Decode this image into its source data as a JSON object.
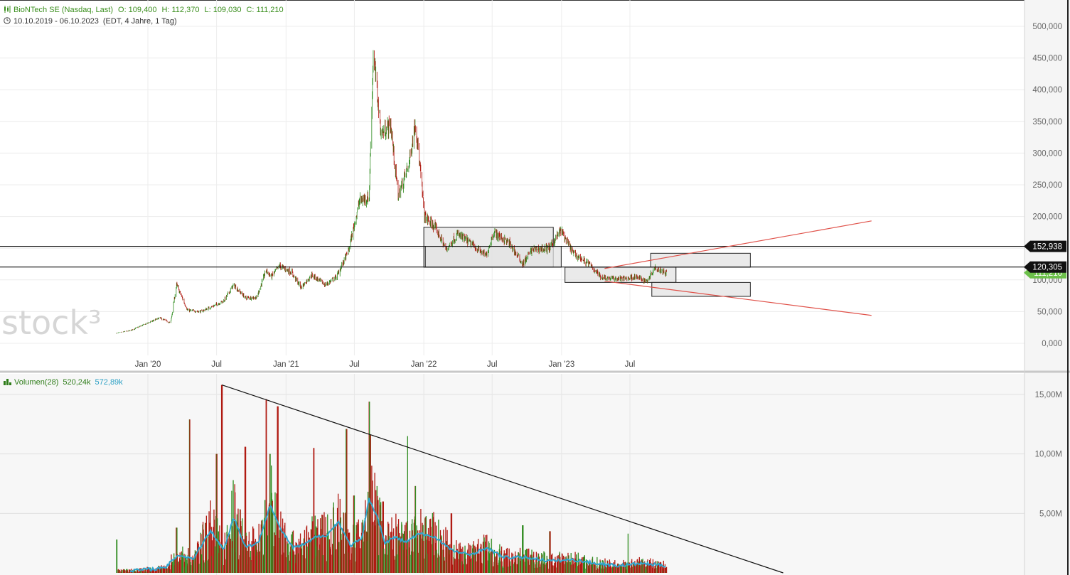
{
  "header": {
    "instrument": "BioNTech SE (Nasdaq, Last)",
    "open": "O: 109,400",
    "high": "H: 112,370",
    "low": "L: 109,030",
    "close": "C: 111,210",
    "range": "10.10.2019 - 06.10.2023",
    "range_note": "(EDT, 4 Jahre, 1 Tag)"
  },
  "volume_header": {
    "title": "Volumen(28)",
    "value1": "520,24k",
    "value2": "572,89k"
  },
  "watermark": "stock³",
  "price_axis_labels": [
    "500,000",
    "450,000",
    "400,000",
    "350,000",
    "300,000",
    "250,000",
    "200,000",
    "150,000",
    "100,000",
    "50,000",
    "0,000"
  ],
  "volume_axis_labels": [
    "15,00M",
    "10,00M",
    "5,00M"
  ],
  "x_axis_labels": [
    "Jan '20",
    "Jul",
    "Jan '21",
    "Jul",
    "Jan '22",
    "Jul",
    "Jan '23",
    "Jul"
  ],
  "horizontal_level_labels": [
    "152,938",
    "120,305"
  ],
  "current_price_label": "111,210",
  "colors": {
    "up": "#2e8b1e",
    "down": "#b01a12",
    "volume_ma": "#2fa6cf",
    "trendline_red": "#e0524a",
    "level_label_bg": "#111111",
    "current_label_bg": "#6cc04a",
    "box_fill": "#e3e3e3"
  },
  "chart_data": [
    {
      "type": "line",
      "chart_kind": "candlestick",
      "x_type": "date",
      "x_range": [
        "2019-10-10",
        "2023-10-06"
      ],
      "ylim": [
        0,
        500
      ],
      "series": [
        {
          "x": [
            "2019-10-10",
            "2019-11-15",
            "2019-12-20",
            "2020-02-01",
            "2020-03-01",
            "2020-03-17",
            "2020-04-15",
            "2020-05-20",
            "2020-06-20",
            "2020-07-20",
            "2020-08-15",
            "2020-09-15",
            "2020-10-15",
            "2020-11-09",
            "2020-11-23",
            "2020-12-15",
            "2021-01-15",
            "2021-02-10",
            "2021-03-10",
            "2021-04-15",
            "2021-05-15",
            "2021-06-15",
            "2021-07-15",
            "2021-08-09",
            "2021-08-20",
            "2021-09-10",
            "2021-10-05",
            "2021-10-25",
            "2021-11-22",
            "2021-12-10",
            "2022-01-03",
            "2022-02-01",
            "2022-03-01",
            "2022-04-01",
            "2022-05-10",
            "2022-06-15",
            "2022-07-05",
            "2022-08-15",
            "2022-09-20",
            "2022-10-15",
            "2022-11-30",
            "2022-12-30",
            "2023-02-01",
            "2023-03-15",
            "2023-04-15",
            "2023-05-15",
            "2023-06-15",
            "2023-07-15",
            "2023-08-15",
            "2023-09-05",
            "2023-10-06"
          ],
          "y": [
            16,
            20,
            29,
            40,
            32,
            92,
            52,
            50,
            58,
            67,
            92,
            72,
            72,
            115,
            105,
            122,
            112,
            88,
            108,
            92,
            105,
            145,
            225,
            230,
            458,
            330,
            345,
            232,
            282,
            350,
            200,
            182,
            148,
            172,
            155,
            138,
            175,
            158,
            125,
            148,
            150,
            178,
            142,
            125,
            105,
            102,
            102,
            105,
            98,
            120,
            111
          ]
        }
      ],
      "horizontal_levels": [
        152.938,
        120.305
      ],
      "current_price": 111.21,
      "zones": [
        {
          "x": [
            "2022-01-01",
            "2022-12-10"
          ],
          "y": [
            120,
            183
          ]
        },
        {
          "x": [
            "2022-01-05",
            "2022-12-31"
          ],
          "y": [
            120,
            153
          ]
        },
        {
          "x": [
            "2023-01-10",
            "2023-10-31"
          ],
          "y": [
            96,
            120
          ]
        },
        {
          "x": [
            "2023-08-25",
            "2024-05-15"
          ],
          "y": [
            120,
            142
          ]
        },
        {
          "x": [
            "2023-08-28",
            "2024-05-15"
          ],
          "y": [
            74,
            96
          ]
        }
      ],
      "trendlines": [
        {
          "x": [
            "2023-04-25",
            "2025-04-01"
          ],
          "y": [
            118,
            193
          ]
        },
        {
          "x": [
            "2023-04-25",
            "2025-04-01"
          ],
          "y": [
            98,
            44
          ]
        }
      ]
    },
    {
      "type": "bar",
      "title": "Volumen(28)",
      "x_type": "date",
      "x_range": [
        "2019-10-10",
        "2023-10-06"
      ],
      "ylim": [
        0,
        17.0
      ],
      "units": "M",
      "ma_period": 28,
      "spikes": {
        "x": [
          "2019-10-10",
          "2020-03-17",
          "2020-04-20",
          "2020-06-01",
          "2020-07-01",
          "2020-07-15",
          "2020-08-15",
          "2020-09-15",
          "2020-11-09",
          "2020-11-20",
          "2020-12-10",
          "2021-02-20",
          "2021-03-15",
          "2021-05-10",
          "2021-06-10",
          "2021-06-30",
          "2021-08-09",
          "2021-08-12",
          "2021-09-15",
          "2021-11-20",
          "2021-12-10",
          "2022-03-15",
          "2022-09-20",
          "2022-12-01",
          "2023-06-25"
        ],
        "y": [
          2.8,
          3.8,
          12.9,
          4.2,
          10.0,
          15.8,
          7.8,
          10.6,
          14.6,
          10.0,
          14.0,
          3.6,
          10.5,
          4.0,
          12.1,
          6.5,
          14.4,
          11.6,
          6.0,
          11.5,
          7.3,
          5.0,
          4.0,
          3.5,
          3.3
        ]
      },
      "moving_average": {
        "x": [
          "2019-11-15",
          "2020-02-15",
          "2020-03-20",
          "2020-05-01",
          "2020-06-15",
          "2020-07-20",
          "2020-08-15",
          "2020-09-15",
          "2020-10-20",
          "2020-11-20",
          "2020-12-15",
          "2021-01-20",
          "2021-02-20",
          "2021-03-20",
          "2021-04-20",
          "2021-05-20",
          "2021-06-20",
          "2021-07-20",
          "2021-08-09",
          "2021-08-30",
          "2021-09-20",
          "2021-10-15",
          "2021-11-15",
          "2021-12-20",
          "2022-02-01",
          "2022-03-15",
          "2022-05-01",
          "2022-06-15",
          "2022-08-01",
          "2022-10-01",
          "2022-12-01",
          "2023-02-01",
          "2023-04-01",
          "2023-06-01",
          "2023-08-01",
          "2023-10-06"
        ],
        "y": [
          0.2,
          0.4,
          1.5,
          1.2,
          3.6,
          1.9,
          4.7,
          2.2,
          2.5,
          5.8,
          3.8,
          2.1,
          2.4,
          3.0,
          3.2,
          4.3,
          2.3,
          2.8,
          6.2,
          4.8,
          2.5,
          3.0,
          2.6,
          3.3,
          3.0,
          1.9,
          1.5,
          2.1,
          1.3,
          1.3,
          1.0,
          1.1,
          0.8,
          0.6,
          0.8,
          0.6
        ]
      },
      "trendline": {
        "x": [
          "2020-07-15",
          "2024-08-10"
        ],
        "y": [
          15.8,
          0
        ]
      }
    }
  ]
}
